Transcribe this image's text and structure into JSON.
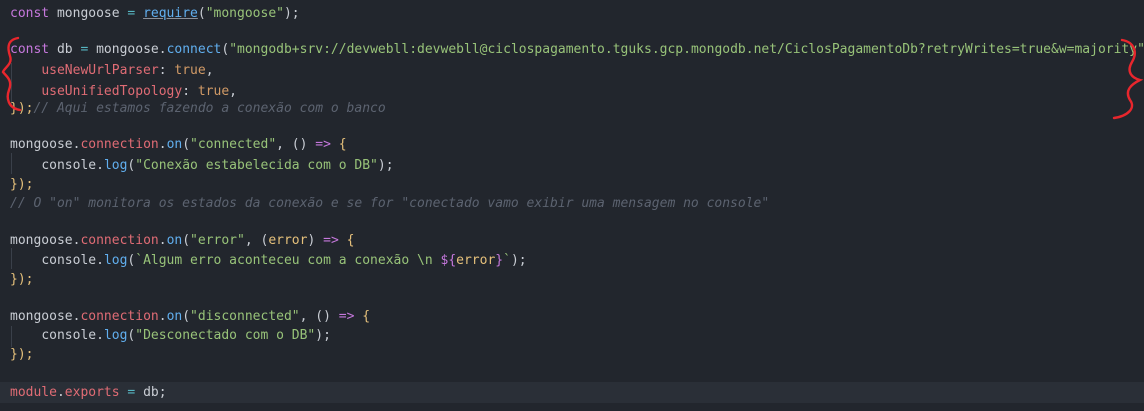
{
  "editor": {
    "language": "javascript",
    "lines": {
      "l1": {
        "const": "const",
        "name": " mongoose ",
        "eq": "=",
        "sp": " ",
        "require": "require",
        "open": "(",
        "str": "\"mongoose\"",
        "close": ");"
      },
      "l3": {
        "const": "const",
        "name": " db ",
        "eq": "=",
        "obj": " mongoose",
        "dot": ".",
        "fn": "connect",
        "open": "(",
        "str": "\"mongodb+srv://devwebll:devwebll@ciclospagamento.tguks.gcp.mongodb.net/CiclosPagamentoDb?retryWrites=true&w=majority\"",
        "comma": ","
      },
      "l4": {
        "indent": "    ",
        "prop": "useNewUrlParser",
        "colon": ": ",
        "val": "true",
        "comma": ","
      },
      "l5": {
        "indent": "    ",
        "prop": "useUnifiedTopology",
        "colon": ": ",
        "val": "true",
        "comma": ","
      },
      "l6": {
        "close": "});",
        "comment": "// Aqui estamos fazendo a conexão com o banco"
      },
      "l8": {
        "obj": "mongoose",
        "dot1": ".",
        "prop": "connection",
        "dot2": ".",
        "fn": "on",
        "open": "(",
        "str": "\"connected\"",
        "comma": ", ",
        "params": "()",
        "arrow": " => ",
        "brace": "{"
      },
      "l9": {
        "indent": "    ",
        "obj": "console",
        "dot": ".",
        "fn": "log",
        "open": "(",
        "str": "\"Conexão estabelecida com o DB\"",
        "close": ");"
      },
      "l10": {
        "close": "});"
      },
      "l11": {
        "comment": "// O \"on\" monitora os estados da conexão e se for \"conectado vamo exibir uma mensagem no console\""
      },
      "l13": {
        "obj": "mongoose",
        "dot1": ".",
        "prop": "connection",
        "dot2": ".",
        "fn": "on",
        "open": "(",
        "str": "\"error\"",
        "comma": ", ",
        "popen": "(",
        "param": "error",
        "pclose": ")",
        "arrow": " => ",
        "brace": "{"
      },
      "l14": {
        "indent": "    ",
        "obj": "console",
        "dot": ".",
        "fn": "log",
        "open": "(",
        "str": "`Algum erro aconteceu com a conexão \\n ",
        "interp_open": "${",
        "interp_var": "error",
        "interp_close": "}",
        "str_end": "`",
        "close": ");"
      },
      "l15": {
        "close": "});"
      },
      "l17": {
        "obj": "mongoose",
        "dot1": ".",
        "prop": "connection",
        "dot2": ".",
        "fn": "on",
        "open": "(",
        "str": "\"disconnected\"",
        "comma": ", ",
        "params": "()",
        "arrow": " => ",
        "brace": "{"
      },
      "l18": {
        "indent": "    ",
        "obj": "console",
        "dot": ".",
        "fn": "log",
        "open": "(",
        "str": "\"Desconectado com o DB\"",
        "close": ");"
      },
      "l19": {
        "close": "});"
      },
      "l21": {
        "obj": "module",
        "dot": ".",
        "prop": "exports",
        "eq": " = ",
        "val": "db",
        "semi": ";"
      }
    }
  },
  "annotation": {
    "color": "#e8262d",
    "description": "hand-drawn red curly braces"
  }
}
